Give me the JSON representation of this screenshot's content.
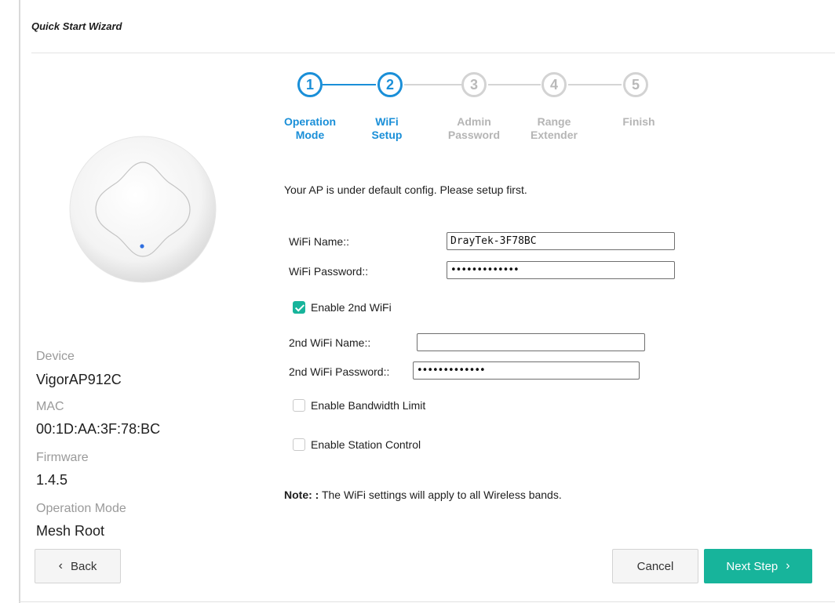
{
  "wizard": {
    "title": "Quick Start Wizard"
  },
  "steps": [
    {
      "number": "1",
      "label": "Operation\nMode",
      "state": "active"
    },
    {
      "number": "2",
      "label": "WiFi\nSetup",
      "state": "active"
    },
    {
      "number": "3",
      "label": "Admin\nPassword",
      "state": "inactive"
    },
    {
      "number": "4",
      "label": "Range\nExtender",
      "state": "inactive"
    },
    {
      "number": "5",
      "label": "Finish",
      "state": "inactive"
    }
  ],
  "device_info": {
    "device_label": "Device",
    "device_value": "VigorAP912C",
    "mac_label": "MAC",
    "mac_value": "00:1D:AA:3F:78:BC",
    "firmware_label": "Firmware",
    "firmware_value": "1.4.5",
    "opmode_label": "Operation Mode",
    "opmode_value": "Mesh Root"
  },
  "form": {
    "intro": "Your AP is under default config. Please setup first.",
    "wifi_name_label": "WiFi Name::",
    "wifi_name_value": "DrayTek-3F78BC",
    "wifi_password_label": "WiFi Password::",
    "wifi_password_value": "•••••••••••••",
    "enable_2nd_wifi_label": "Enable 2nd WiFi",
    "enable_2nd_wifi_checked": true,
    "wifi2_name_label": "2nd WiFi Name::",
    "wifi2_name_value": "",
    "wifi2_password_label": "2nd WiFi Password::",
    "wifi2_password_value": "•••••••••••••",
    "bandwidth_limit_label": "Enable Bandwidth Limit",
    "bandwidth_limit_checked": false,
    "station_control_label": "Enable Station Control",
    "station_control_checked": false,
    "note_prefix": "Note: :",
    "note_text": " The WiFi settings will apply to all Wireless bands."
  },
  "buttons": {
    "back": "Back",
    "cancel": "Cancel",
    "next": "Next Step"
  },
  "icons": {
    "back_chevron": "chevron-left-icon",
    "next_chevron": "chevron-right-icon",
    "check": "checkmark-icon"
  },
  "colors": {
    "accent_blue": "#1a8fd8",
    "primary_green": "#17b49b",
    "inactive_gray": "#d3d3d3"
  }
}
